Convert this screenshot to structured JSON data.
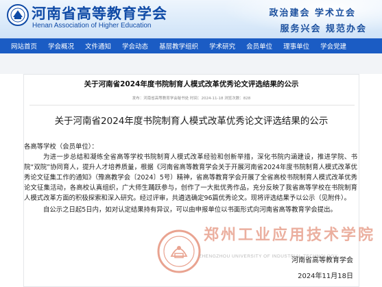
{
  "header": {
    "site_name": "河南省高等教育学会",
    "site_name_en": "Henan Association of Higher Education",
    "slogan_line1": "政治建会  学术立会",
    "slogan_line2": "服务兴会  规范办会"
  },
  "nav": {
    "items": [
      {
        "label": "网站首页"
      },
      {
        "label": "学会概况"
      },
      {
        "label": "文件通知"
      },
      {
        "label": "学会动态"
      },
      {
        "label": "基层教学组织"
      },
      {
        "label": "学术研究"
      },
      {
        "label": "会员单位"
      },
      {
        "label": "理事单位"
      },
      {
        "label": "学会党建"
      }
    ]
  },
  "article": {
    "card_title": "关于河南省2024年度书院制育人模式改革优秀论文评选结果的公示",
    "meta": "发布：河南省高等教育学会秘书处   时间：2024-11-18   浏览次数：828",
    "doc_title": "关于河南省2024年度书院制育人模式改革优秀论文评选结果的公示",
    "salutation": "各高等学校（会员单位）：",
    "paragraph1": "为进一步总结和凝练全省高等学校书院制育人模式改革经验和创新举措，深化书院内涵建设，推进学院、书院“双院”协同育人，提升人才培养质量，根据《河南省高等教育学会关于开展河南省2024年度书院制育人模式改革优秀论文征集工作的通知》（豫高教学会〔2024〕5号）精神，省高等教育学会开展了全省高校书院制育人模式改革优秀论文征集活动，各高校认真组织，广大师生踊跃参与，创作了一大批优秀作品，充分反映了我省高等学校在书院制育人模式改革方面的积极探索和深入研究。经过评审，共遴选确定96篇优秀论文。现将评选结果予以公示（见附件）。",
    "paragraph2": "自公示之日起5日内，如对认定结果持有异议，可以由申报单位以书面形式向河南省高等教育学会提出。",
    "signature_org": "河南省高等教育学会",
    "signature_date": "2024年11月18日"
  },
  "watermark": {
    "school_name_cn": "郑州工业应用技术学院",
    "school_name_en": "ZHENGZHOU UNIVERSITY OF INDUSTRIAL TECHNOLOGY"
  },
  "colors": {
    "nav_bg": "#1b5cc4",
    "brand_blue": "#0f4aa6",
    "stamp_red": "#e07a66"
  }
}
